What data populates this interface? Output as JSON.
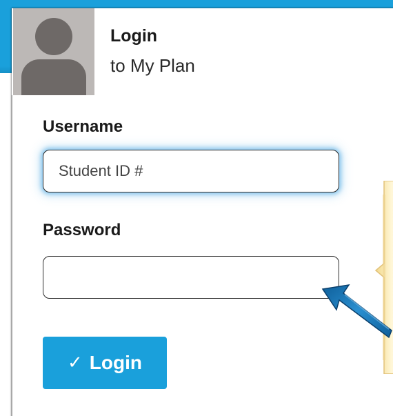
{
  "header": {
    "title": "Login",
    "subtitle": "to My Plan"
  },
  "avatar": {
    "icon": "user-avatar-icon"
  },
  "form": {
    "username_label": "Username",
    "username_placeholder": "Student ID #",
    "username_value": "",
    "password_label": "Password",
    "password_value": "",
    "login_button_label": "Login",
    "login_button_icon": "check-icon"
  },
  "colors": {
    "accent": "#1aa0db",
    "avatar_bg": "#bcb8b6",
    "avatar_fg": "#6e6967",
    "focus_glow": "#78bee8",
    "callout_fill": "#fbf0c8",
    "arrow_fill": "#1e7fbf"
  }
}
